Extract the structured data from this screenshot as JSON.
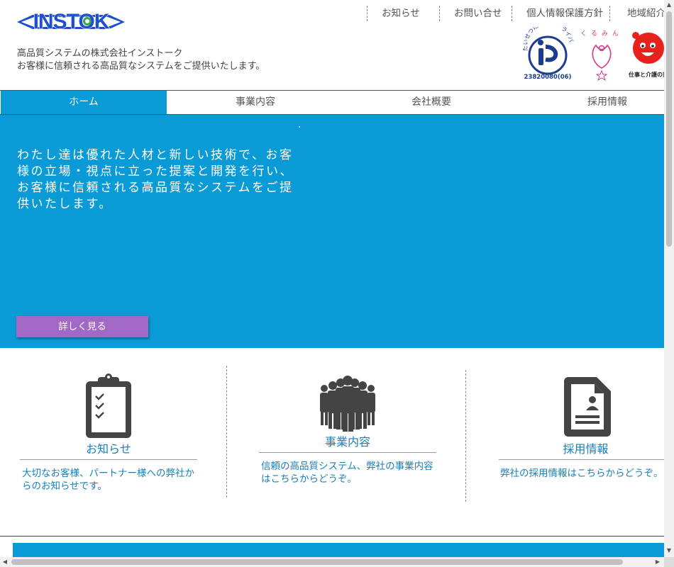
{
  "header": {
    "logo_text": "INSTOK",
    "tagline_1": "高品質システムの株式会社インストーク",
    "tagline_2": "お客様に信頼される高品質なシステムをご提供いたします。",
    "top_links": [
      "お知らせ",
      "お問い合せ",
      "個人情報保護方針",
      "地域紹介"
    ],
    "privacy_mark_number": "23820080(06)",
    "privacy_mark_text": "たいせつにしますプライバシー",
    "kurumin_text": "くるみん",
    "care_badge_text": "仕事と介護の両立"
  },
  "nav": {
    "items": [
      "ホーム",
      "事業内容",
      "会社概要",
      "採用情報"
    ]
  },
  "hero": {
    "text": "わたし達は優れた人材と新しい技術で、お客様の立場・視点に立った提案と開発を行い、お客様に信頼される高品質なシステムをご提供いたします。",
    "button_label": "詳しく見る"
  },
  "cards": [
    {
      "title": "お知らせ",
      "description": "大切なお客様、パートナー様への弊社からのお知らせです。"
    },
    {
      "title": "事業内容",
      "description": "信頼の高品質システム、弊社の事業内容はこちらからどうぞ。"
    },
    {
      "title": "採用情報",
      "description": "弊社の採用情報はこちらからどうぞ。"
    }
  ],
  "colors": {
    "accent_blue": "#0a9ad6",
    "button_purple": "#a169c5",
    "card_text_blue": "#1a7fb8",
    "logo_blue": "#1e4fcf",
    "icon_gray": "#444444"
  },
  "icons": {
    "notice": "clipboard-checklist-icon",
    "business": "people-group-icon",
    "recruit": "resume-document-icon"
  }
}
